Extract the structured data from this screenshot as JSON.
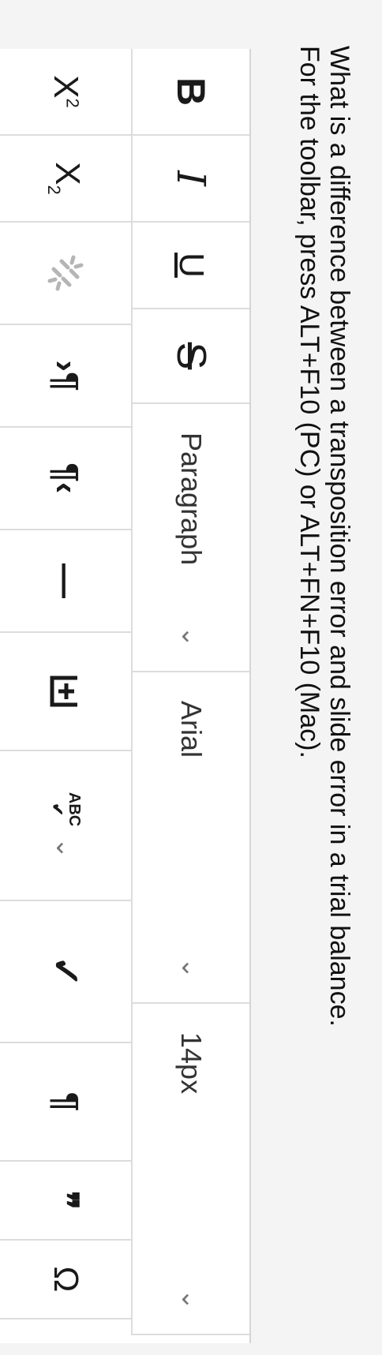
{
  "question": {
    "line1": "What is a difference between a transposition error and slide error in a trial balance.",
    "line2": "For the toolbar, press ALT+F10 (PC) or ALT+FN+F10 (Mac)."
  },
  "toolbar": {
    "bold_label": "B",
    "italic_label": "I",
    "underline_label": "U",
    "strike_label": "S",
    "format_select": "Paragraph",
    "font_select": "Arial",
    "size_select": "14px",
    "superscript_base": "X",
    "superscript_exp": "2",
    "subscript_base": "X",
    "subscript_exp": "2",
    "ltr_label": "¶",
    "rtl_label": "¶",
    "hr_label": "—",
    "spellcheck_label": "ABC",
    "show_blocks_label": "¶",
    "blockquote_label": "❞",
    "special_char_label": "Ω"
  },
  "icons": [
    "bold-icon",
    "italic-icon",
    "underline-icon",
    "strikethrough-icon",
    "chevron-down-icon",
    "superscript-icon",
    "subscript-icon",
    "unlink-icon",
    "ltr-paragraph-icon",
    "rtl-paragraph-icon",
    "horizontal-line-icon",
    "insert-icon",
    "spellcheck-icon",
    "checkmark-icon",
    "pilcrow-icon",
    "blockquote-icon",
    "omega-icon"
  ]
}
